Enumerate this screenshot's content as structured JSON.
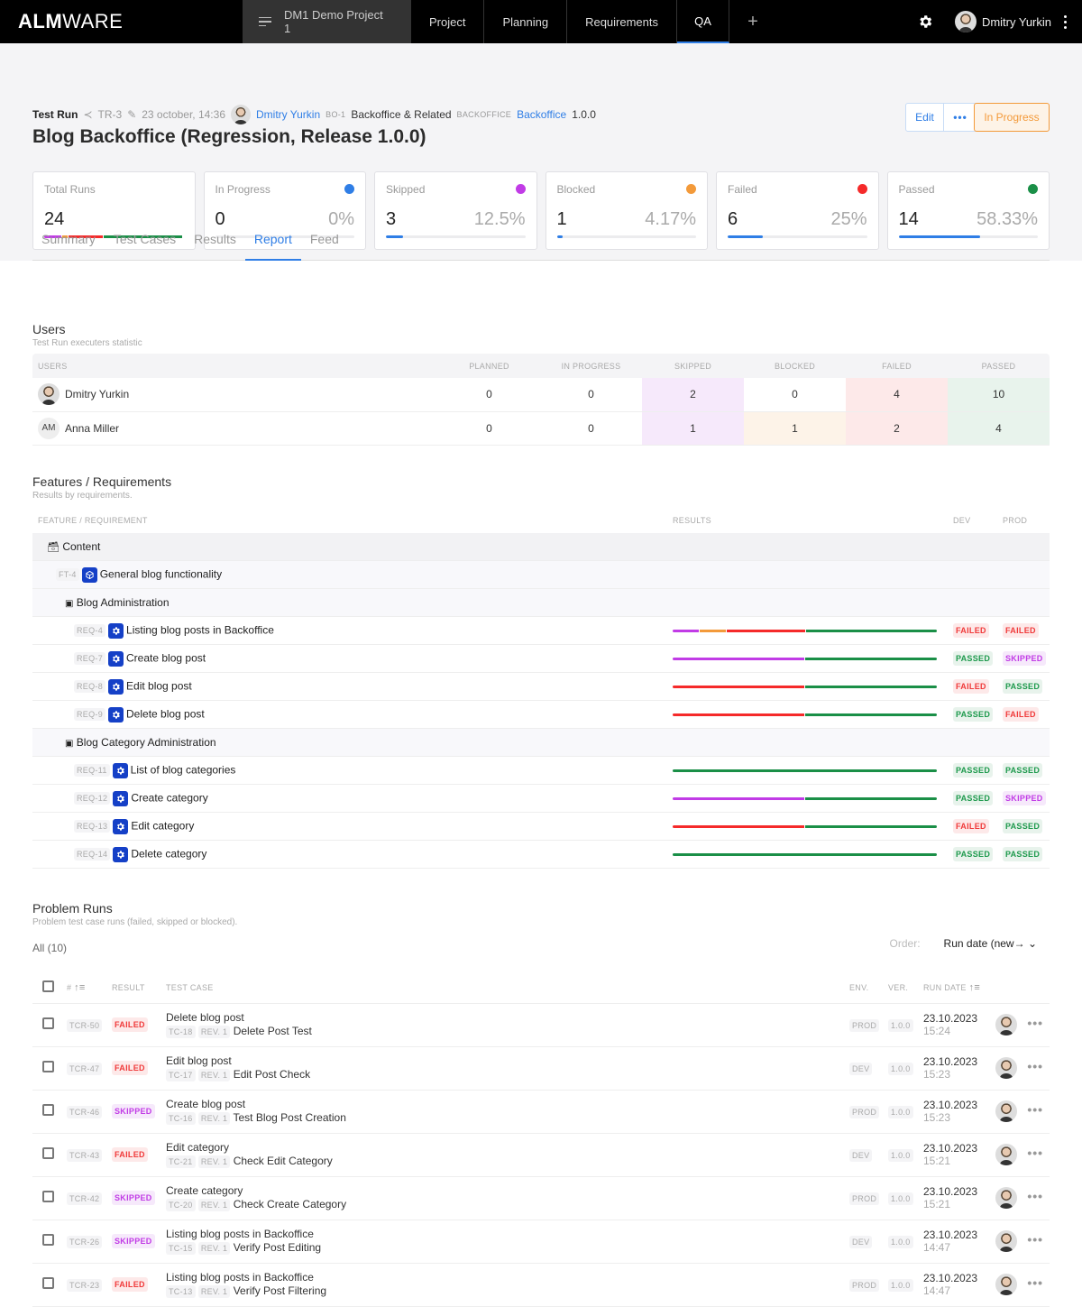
{
  "topbar": {
    "logo_bold": "ALM",
    "logo_light": "WARE",
    "project": "DM1 Demo Project 1",
    "nav": [
      "Project",
      "Planning",
      "Requirements",
      "QA"
    ],
    "active_nav": "QA",
    "plus": "+",
    "user": "Dmitry Yurkin"
  },
  "header": {
    "type": "Test Run",
    "id": "TR-3",
    "edited": "23 october, 14:36",
    "author": "Dmitry Yurkin",
    "bo_tag": "BO-1",
    "bo_name": "Backoffice & Related",
    "product_tag": "BACKOFFICE",
    "product": "Backoffice",
    "version": "1.0.0",
    "title": "Blog Backoffice (Regression, Release 1.0.0)",
    "edit_label": "Edit",
    "more_label": "•••",
    "status": "In Progress"
  },
  "colors": {
    "in_progress": "#2f7ee6",
    "skipped": "#c13be6",
    "blocked": "#f39a3a",
    "failed": "#f52a2a",
    "passed": "#1a8f47"
  },
  "stats": {
    "total": {
      "label": "Total Runs",
      "value": "24",
      "segments": [
        {
          "status": "skipped",
          "pct": 12.5
        },
        {
          "status": "blocked",
          "pct": 4.17
        },
        {
          "status": "failed",
          "pct": 25
        },
        {
          "status": "passed",
          "pct": 58.33
        }
      ]
    },
    "cards": [
      {
        "key": "in_progress",
        "label": "In Progress",
        "value": "0",
        "pct": "0%",
        "fill": 0
      },
      {
        "key": "skipped",
        "label": "Skipped",
        "value": "3",
        "pct": "12.5%",
        "fill": 12.5
      },
      {
        "key": "blocked",
        "label": "Blocked",
        "value": "1",
        "pct": "4.17%",
        "fill": 4.17
      },
      {
        "key": "failed",
        "label": "Failed",
        "value": "6",
        "pct": "25%",
        "fill": 25
      },
      {
        "key": "passed",
        "label": "Passed",
        "value": "14",
        "pct": "58.33%",
        "fill": 58.33
      }
    ]
  },
  "tabs": [
    "Summary",
    "Test Cases",
    "Results",
    "Report",
    "Feed"
  ],
  "active_tab": "Report",
  "users_section": {
    "title": "Users",
    "subtitle": "Test Run executers statistic",
    "columns": [
      "USERS",
      "PLANNED",
      "IN PROGRESS",
      "SKIPPED",
      "BLOCKED",
      "FAILED",
      "PASSED"
    ],
    "rows": [
      {
        "name": "Dmitry Yurkin",
        "avatar": "photo",
        "planned": "0",
        "in_progress": "0",
        "skipped": "2",
        "blocked": "0",
        "failed": "4",
        "passed": "10"
      },
      {
        "name": "Anna Miller",
        "avatar": "AM",
        "planned": "0",
        "in_progress": "0",
        "skipped": "1",
        "blocked": "1",
        "failed": "2",
        "passed": "4"
      }
    ]
  },
  "features_section": {
    "title": "Features / Requirements",
    "subtitle": "Results by requirements.",
    "columns": [
      "FEATURE / REQUIREMENT",
      "RESULTS",
      "DEV",
      "PROD"
    ],
    "group": "Content",
    "feature": {
      "id": "FT-4",
      "name": "General blog functionality"
    },
    "subgroups": [
      {
        "name": "Blog Administration",
        "reqs": [
          {
            "id": "REQ-4",
            "name": "Listing blog posts in Backoffice",
            "results": [
              {
                "status": "skipped",
                "pct": 10
              },
              {
                "status": "blocked",
                "pct": 10
              },
              {
                "status": "failed",
                "pct": 30
              },
              {
                "status": "passed",
                "pct": 50
              }
            ],
            "dev": "FAILED",
            "prod": "FAILED"
          },
          {
            "id": "REQ-7",
            "name": "Create blog post",
            "results": [
              {
                "status": "skipped",
                "pct": 50
              },
              {
                "status": "passed",
                "pct": 50
              }
            ],
            "dev": "PASSED",
            "prod": "SKIPPED"
          },
          {
            "id": "REQ-8",
            "name": "Edit blog post",
            "results": [
              {
                "status": "failed",
                "pct": 50
              },
              {
                "status": "passed",
                "pct": 50
              }
            ],
            "dev": "FAILED",
            "prod": "PASSED"
          },
          {
            "id": "REQ-9",
            "name": "Delete blog post",
            "results": [
              {
                "status": "failed",
                "pct": 50
              },
              {
                "status": "passed",
                "pct": 50
              }
            ],
            "dev": "PASSED",
            "prod": "FAILED"
          }
        ]
      },
      {
        "name": "Blog Category Administration",
        "reqs": [
          {
            "id": "REQ-11",
            "name": "List of blog categories",
            "results": [
              {
                "status": "passed",
                "pct": 100
              }
            ],
            "dev": "PASSED",
            "prod": "PASSED"
          },
          {
            "id": "REQ-12",
            "name": "Create category",
            "results": [
              {
                "status": "skipped",
                "pct": 50
              },
              {
                "status": "passed",
                "pct": 50
              }
            ],
            "dev": "PASSED",
            "prod": "SKIPPED"
          },
          {
            "id": "REQ-13",
            "name": "Edit category",
            "results": [
              {
                "status": "failed",
                "pct": 50
              },
              {
                "status": "passed",
                "pct": 50
              }
            ],
            "dev": "FAILED",
            "prod": "PASSED"
          },
          {
            "id": "REQ-14",
            "name": "Delete category",
            "results": [
              {
                "status": "passed",
                "pct": 100
              }
            ],
            "dev": "PASSED",
            "prod": "PASSED"
          }
        ]
      }
    ]
  },
  "problem_runs": {
    "title": "Problem Runs",
    "subtitle": "Problem test case runs (failed, skipped or blocked).",
    "filter": "All (10)",
    "order_label": "Order:",
    "order_value": "Run date (new→",
    "columns": [
      "#",
      "RESULT",
      "TEST CASE",
      "ENV.",
      "VER.",
      "RUN DATE"
    ],
    "rows": [
      {
        "id": "TCR-50",
        "result": "FAILED",
        "req": "Delete blog post",
        "tc": "TC-18",
        "rev": "REV. 1",
        "tc_name": "Delete Post Test",
        "env": "PROD",
        "ver": "1.0.0",
        "date": "23.10.2023",
        "time": "15:24"
      },
      {
        "id": "TCR-47",
        "result": "FAILED",
        "req": "Edit blog post",
        "tc": "TC-17",
        "rev": "REV. 1",
        "tc_name": "Edit Post Check",
        "env": "DEV",
        "ver": "1.0.0",
        "date": "23.10.2023",
        "time": "15:23"
      },
      {
        "id": "TCR-46",
        "result": "SKIPPED",
        "req": "Create blog post",
        "tc": "TC-16",
        "rev": "REV. 1",
        "tc_name": "Test Blog Post Creation",
        "env": "PROD",
        "ver": "1.0.0",
        "date": "23.10.2023",
        "time": "15:23"
      },
      {
        "id": "TCR-43",
        "result": "FAILED",
        "req": "Edit category",
        "tc": "TC-21",
        "rev": "REV. 1",
        "tc_name": "Check Edit Category",
        "env": "DEV",
        "ver": "1.0.0",
        "date": "23.10.2023",
        "time": "15:21"
      },
      {
        "id": "TCR-42",
        "result": "SKIPPED",
        "req": "Create category",
        "tc": "TC-20",
        "rev": "REV. 1",
        "tc_name": "Check Create Category",
        "env": "PROD",
        "ver": "1.0.0",
        "date": "23.10.2023",
        "time": "15:21"
      },
      {
        "id": "TCR-26",
        "result": "SKIPPED",
        "req": "Listing blog posts in Backoffice",
        "tc": "TC-15",
        "rev": "REV. 1",
        "tc_name": "Verify Post Editing",
        "env": "DEV",
        "ver": "1.0.0",
        "date": "23.10.2023",
        "time": "14:47"
      },
      {
        "id": "TCR-23",
        "result": "FAILED",
        "req": "Listing blog posts in Backoffice",
        "tc": "TC-13",
        "rev": "REV. 1",
        "tc_name": "Verify Post Filtering",
        "env": "PROD",
        "ver": "1.0.0",
        "date": "23.10.2023",
        "time": "14:47"
      }
    ]
  }
}
